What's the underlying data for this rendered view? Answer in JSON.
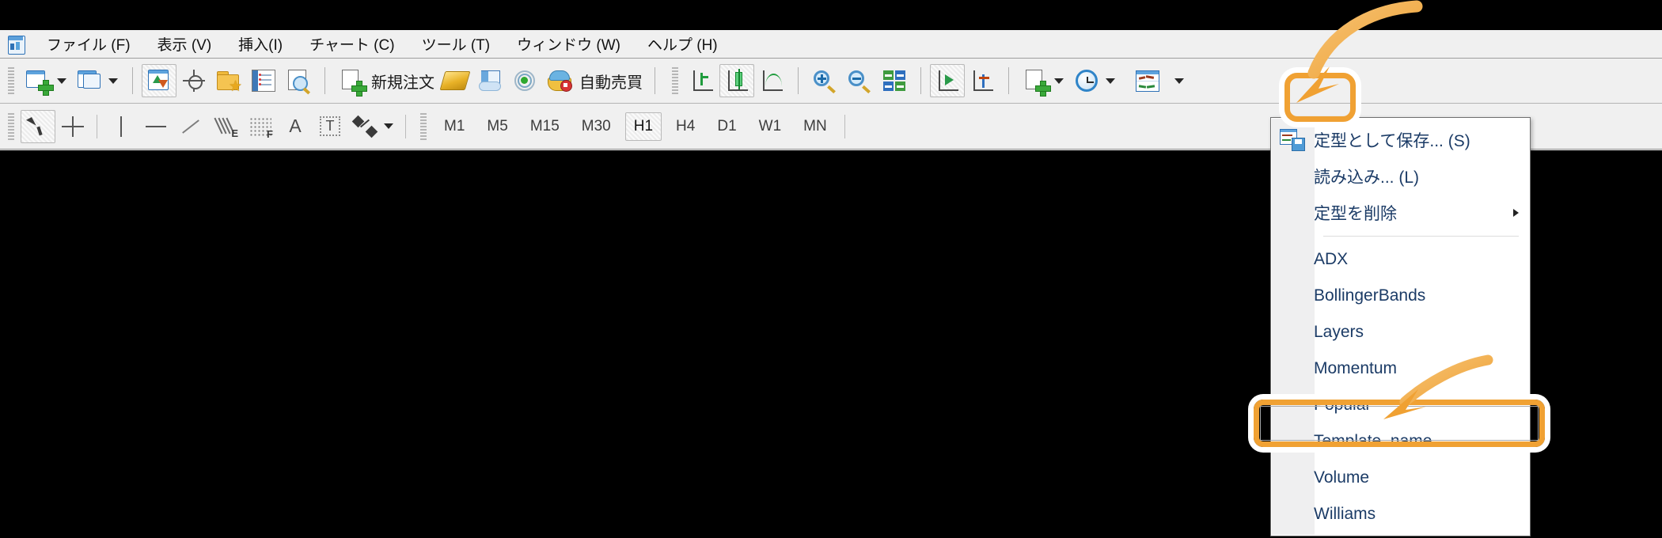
{
  "app": {
    "name": "MetaTrader chart platform",
    "logo_icon": "metatrader-logo-icon",
    "accent_color": "#f0a133",
    "chart_background": "#000000"
  },
  "menubar": {
    "items": [
      {
        "label": "ファイル (F)",
        "name": "menu-file"
      },
      {
        "label": "表示 (V)",
        "name": "menu-view"
      },
      {
        "label": "挿入(I)",
        "name": "menu-insert"
      },
      {
        "label": "チャート (C)",
        "name": "menu-chart"
      },
      {
        "label": "ツール (T)",
        "name": "menu-tools"
      },
      {
        "label": "ウィンドウ (W)",
        "name": "menu-window"
      },
      {
        "label": "ヘルプ (H)",
        "name": "menu-help"
      }
    ]
  },
  "toolbar_main": {
    "buttons": [
      {
        "name": "new-chart-button",
        "icon": "new-chart-icon",
        "has_caret": true
      },
      {
        "name": "profiles-button",
        "icon": "profiles-icon",
        "has_caret": true
      },
      {
        "name": "market-watch-button",
        "icon": "market-watch-icon",
        "pressed": true
      },
      {
        "name": "data-window-button",
        "icon": "data-window-icon"
      },
      {
        "name": "navigator-button",
        "icon": "navigator-folder-star-icon"
      },
      {
        "name": "terminal-button",
        "icon": "terminal-notepad-icon"
      },
      {
        "name": "strategy-tester-button",
        "icon": "strategy-tester-magnifier-icon"
      },
      {
        "name": "new-order-button",
        "icon": "new-order-icon",
        "label": "新規注文"
      },
      {
        "name": "metaeditor-button",
        "icon": "gold-bar-icon"
      },
      {
        "name": "mql5-community-button",
        "icon": "book-cloud-icon"
      },
      {
        "name": "signals-button",
        "icon": "signal-waves-icon"
      },
      {
        "name": "autotrading-button",
        "icon": "autotrading-robot-icon",
        "label": "自動売買"
      },
      {
        "name": "bar-chart-button",
        "icon": "bar-chart-icon"
      },
      {
        "name": "candlestick-chart-button",
        "icon": "candlestick-chart-icon",
        "pressed": true
      },
      {
        "name": "line-chart-button",
        "icon": "line-chart-icon"
      },
      {
        "name": "zoom-in-button",
        "icon": "zoom-in-icon"
      },
      {
        "name": "zoom-out-button",
        "icon": "zoom-out-icon"
      },
      {
        "name": "tile-windows-button",
        "icon": "tile-windows-icon"
      },
      {
        "name": "auto-scroll-button",
        "icon": "auto-scroll-icon",
        "pressed": true
      },
      {
        "name": "chart-shift-button",
        "icon": "chart-shift-icon"
      },
      {
        "name": "indicators-button",
        "icon": "indicators-add-icon",
        "has_caret": true
      },
      {
        "name": "periods-button",
        "icon": "periods-clock-icon",
        "has_caret": true
      },
      {
        "name": "templates-button",
        "icon": "templates-icon",
        "has_caret": true,
        "highlighted": true
      }
    ],
    "new_order_label": "新規注文",
    "autotrading_label": "自動売買"
  },
  "toolbar_tools": {
    "buttons": [
      {
        "name": "cursor-tool",
        "icon": "arrow-cursor-icon",
        "pressed": true
      },
      {
        "name": "crosshair-tool",
        "icon": "crosshair-icon"
      },
      {
        "name": "vertical-line-tool",
        "icon": "vertical-line-icon"
      },
      {
        "name": "horizontal-line-tool",
        "icon": "horizontal-line-icon"
      },
      {
        "name": "trendline-tool",
        "icon": "trendline-icon"
      },
      {
        "name": "equidistant-channel-tool",
        "icon": "equidistant-channel-icon",
        "badge": "E"
      },
      {
        "name": "fibonacci-retracement-tool",
        "icon": "fibonacci-grid-icon",
        "badge": "F"
      },
      {
        "name": "text-tool",
        "icon": "text-a-icon"
      },
      {
        "name": "text-label-tool",
        "icon": "text-label-icon"
      },
      {
        "name": "shapes-tool",
        "icon": "shapes-icon",
        "has_caret": true
      }
    ],
    "timeframes": [
      {
        "label": "M1",
        "active": false
      },
      {
        "label": "M5",
        "active": false
      },
      {
        "label": "M15",
        "active": false
      },
      {
        "label": "M30",
        "active": false
      },
      {
        "label": "H1",
        "active": true
      },
      {
        "label": "H4",
        "active": false
      },
      {
        "label": "D1",
        "active": false
      },
      {
        "label": "W1",
        "active": false
      },
      {
        "label": "MN",
        "active": false
      }
    ]
  },
  "templates_menu": {
    "commands": [
      {
        "label": "定型として保存... (S)",
        "name": "save-template-item",
        "icon": "save-template-icon",
        "has_submenu": false
      },
      {
        "label": "読み込み... (L)",
        "name": "load-template-item",
        "icon": "none",
        "has_submenu": false
      },
      {
        "label": "定型を削除",
        "name": "delete-template-item",
        "icon": "none",
        "has_submenu": true
      }
    ],
    "templates": [
      {
        "label": "ADX",
        "name": "template-item-adx"
      },
      {
        "label": "BollingerBands",
        "name": "template-item-bollingerbands"
      },
      {
        "label": "Layers",
        "name": "template-item-layers"
      },
      {
        "label": "Momentum",
        "name": "template-item-momentum"
      },
      {
        "label": "Popular",
        "name": "template-item-popular"
      },
      {
        "label": "Template_name",
        "name": "template-item-template-name",
        "highlighted": true
      },
      {
        "label": "Volume",
        "name": "template-item-volume"
      },
      {
        "label": "Williams",
        "name": "template-item-williams"
      }
    ]
  },
  "annotations": {
    "arrow_to_templates_button": "curved arrow pointing down-left to the templates toolbar button",
    "arrow_to_template_item": "curved arrow pointing down-left to the Template_name menu entry",
    "highlight_color": "#f0a133"
  }
}
